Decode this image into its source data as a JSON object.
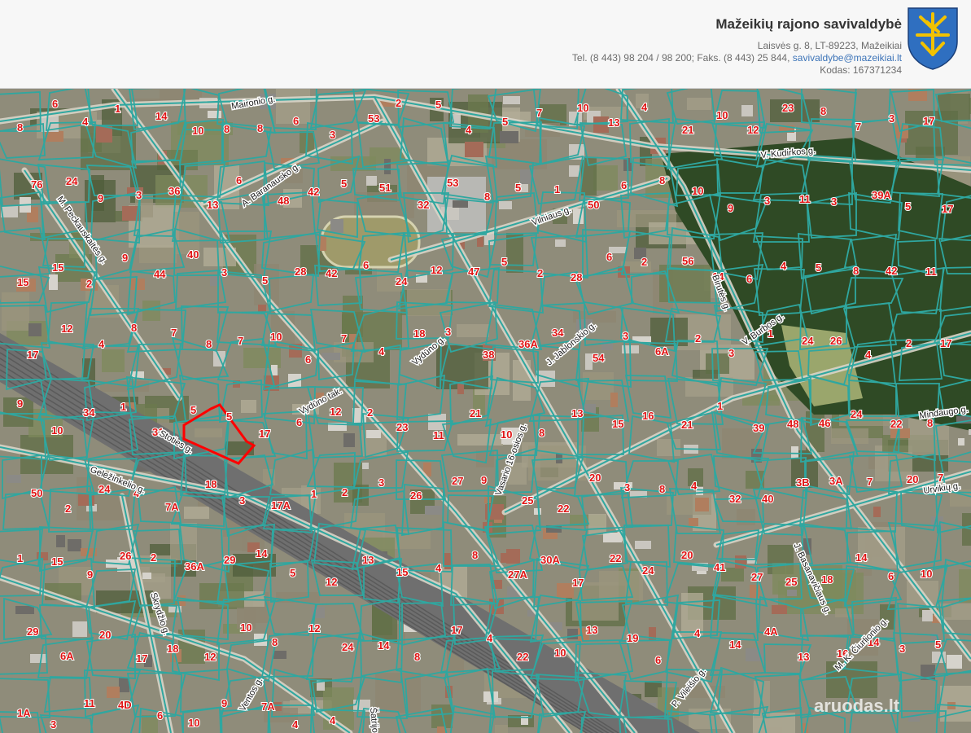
{
  "header": {
    "org_name": "Mažeikių rajono savivaldybė",
    "address": "Laisvės g. 8, LT-89223, Mažeikiai",
    "phone_fax": "Tel. (8 443) 98 204 / 98 200; Faks. (8 443) 25 844,",
    "email": "savivaldybe@mazeikiai.lt",
    "code": "Kodas: 167371234",
    "crest_colors": {
      "shield": "#2f6fc0",
      "emblem": "#f2c200"
    }
  },
  "map": {
    "colors": {
      "parcel_line": "#2fa7a0",
      "parcel_number": "#e01414",
      "highlight": "#ff0000",
      "forest": "#2f4a25",
      "rail": "#7d7d7d"
    },
    "streets": [
      "Maironio g.",
      "M. Peckauskaitės g.",
      "A. Baranausko g.",
      "Vilniaus g.",
      "V. Kudirkos g.",
      "Birutės g.",
      "V. Burbos g.",
      "Mindaugo g.",
      "Urvikių g.",
      "Vydūno g.",
      "Vydūno tak.",
      "Stoties g.",
      "Geležinkelio g.",
      "J. Jablonskio g.",
      "Vasario 16-osios g.",
      "Skrydžio g.",
      "J. Basanavičiaus g.",
      "M. K. Čiurlionio g.",
      "P. Vileišio g.",
      "Šatrijos g.",
      "Ventos g."
    ],
    "parcel_numbers": [
      "8",
      "6",
      "4",
      "1",
      "14",
      "10",
      "8",
      "8",
      "6",
      "3",
      "53",
      "2",
      "5",
      "4",
      "5",
      "7",
      "10",
      "13",
      "4",
      "21",
      "10",
      "12",
      "23",
      "8",
      "7",
      "3",
      "17",
      "76",
      "24",
      "9",
      "3",
      "36",
      "13",
      "6",
      "48",
      "42",
      "5",
      "51",
      "32",
      "53",
      "8",
      "5",
      "1",
      "50",
      "6",
      "8",
      "10",
      "9",
      "3",
      "11",
      "3",
      "39A",
      "5",
      "17",
      "15",
      "15",
      "2",
      "9",
      "44",
      "40",
      "3",
      "5",
      "28",
      "42",
      "6",
      "24",
      "12",
      "47",
      "5",
      "2",
      "28",
      "6",
      "2",
      "56",
      "14",
      "6",
      "4",
      "5",
      "8",
      "42",
      "11",
      "17",
      "12",
      "4",
      "8",
      "7",
      "8",
      "7",
      "10",
      "6",
      "7",
      "4",
      "18",
      "3",
      "38",
      "36A",
      "34",
      "54",
      "3",
      "6A",
      "2",
      "3",
      "1",
      "24",
      "26",
      "4",
      "2",
      "17",
      "9",
      "10",
      "34",
      "1",
      "31",
      "5",
      "5",
      "17",
      "6",
      "12",
      "2",
      "23",
      "11",
      "21",
      "10",
      "8",
      "13",
      "15",
      "16",
      "21",
      "1",
      "39",
      "48",
      "46",
      "24",
      "22",
      "8",
      "50",
      "2",
      "24",
      "4",
      "7A",
      "18",
      "3",
      "17A",
      "1",
      "2",
      "3",
      "26",
      "27",
      "9",
      "25",
      "22",
      "20",
      "3",
      "8",
      "4",
      "32",
      "40",
      "3B",
      "3A",
      "7",
      "20",
      "7",
      "1",
      "15",
      "9",
      "26",
      "2",
      "36A",
      "29",
      "14",
      "5",
      "12",
      "13",
      "15",
      "4",
      "8",
      "27A",
      "30A",
      "17",
      "22",
      "24",
      "20",
      "41",
      "27",
      "25",
      "18",
      "14",
      "6",
      "10",
      "29",
      "6A",
      "20",
      "17",
      "18",
      "12",
      "10",
      "8",
      "12",
      "24",
      "14",
      "8",
      "17",
      "4",
      "22",
      "10",
      "13",
      "19",
      "6",
      "4",
      "14",
      "4A",
      "13",
      "16",
      "14",
      "3",
      "5",
      "1A",
      "3",
      "11",
      "4D",
      "6",
      "10",
      "9",
      "7A",
      "4",
      "4"
    ],
    "watermark": "aruodas.lt"
  }
}
